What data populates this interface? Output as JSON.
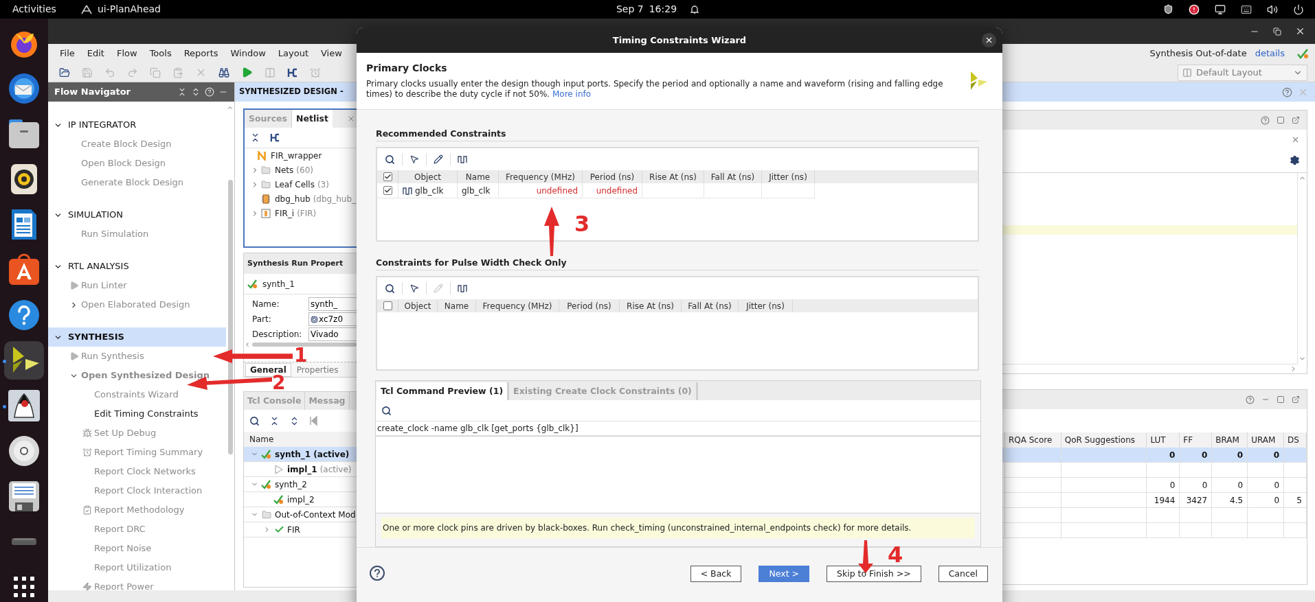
{
  "topbar": {
    "activities": "Activities",
    "app": "ui-PlanAhead",
    "date": "Sep 7",
    "time": "16:29"
  },
  "dock": [
    {
      "kind": "browser",
      "running": false,
      "selected": false
    },
    {
      "kind": "mail",
      "running": false,
      "selected": false
    },
    {
      "kind": "files",
      "running": false,
      "selected": false
    },
    {
      "kind": "music",
      "running": false,
      "selected": false
    },
    {
      "kind": "writer",
      "running": false,
      "selected": false
    },
    {
      "kind": "store",
      "running": false,
      "selected": false
    },
    {
      "kind": "help",
      "running": false,
      "selected": false
    },
    {
      "kind": "vivado",
      "running": true,
      "selected": true
    },
    {
      "kind": "mascot",
      "running": true,
      "selected": false
    },
    {
      "kind": "disc",
      "running": false,
      "selected": false
    },
    {
      "kind": "floppy",
      "running": false,
      "selected": false
    },
    {
      "kind": "drive",
      "running": false,
      "selected": false
    },
    {
      "kind": "apps",
      "running": false,
      "selected": false
    }
  ],
  "menu": [
    "File",
    "Edit",
    "Flow",
    "Tools",
    "Reports",
    "Window",
    "Layout",
    "View"
  ],
  "status": {
    "text": "Synthesis Out-of-date",
    "link": "details"
  },
  "layout_select": {
    "value": "Default Layout"
  },
  "flow_navigator": {
    "title": "Flow Navigator",
    "sections": [
      {
        "title": "IP INTEGRATOR",
        "expanded": true,
        "selected": false,
        "items": [
          {
            "label": "Create Block Design",
            "kind": "plain",
            "disabled": true
          },
          {
            "label": "Open Block Design",
            "kind": "plain",
            "disabled": true
          },
          {
            "label": "Generate Block Design",
            "kind": "plain",
            "disabled": true
          }
        ]
      },
      {
        "title": "SIMULATION",
        "expanded": true,
        "selected": false,
        "items": [
          {
            "label": "Run Simulation",
            "kind": "plain",
            "disabled": true
          }
        ]
      },
      {
        "title": "RTL ANALYSIS",
        "expanded": true,
        "selected": false,
        "items": [
          {
            "label": "Run Linter",
            "kind": "run",
            "disabled": true
          },
          {
            "label": "Open Elaborated Design",
            "kind": "group",
            "disabled": true,
            "expanded": false
          }
        ]
      },
      {
        "title": "SYNTHESIS",
        "expanded": true,
        "selected": true,
        "items": [
          {
            "label": "Run Synthesis",
            "kind": "run",
            "disabled": true
          },
          {
            "label": "Open Synthesized Design",
            "kind": "group",
            "disabled": true,
            "expanded": true,
            "children": [
              {
                "label": "Constraints Wizard",
                "kind": "plain",
                "disabled": true
              },
              {
                "label": "Edit Timing Constraints",
                "kind": "plain",
                "disabled": false
              },
              {
                "label": "Set Up Debug",
                "kind": "debug",
                "disabled": true
              },
              {
                "label": "Report Timing Summary",
                "kind": "timer",
                "disabled": true
              },
              {
                "label": "Report Clock Networks",
                "kind": "plain",
                "disabled": true
              },
              {
                "label": "Report Clock Interaction",
                "kind": "plain",
                "disabled": true
              },
              {
                "label": "Report Methodology",
                "kind": "checklist",
                "disabled": true
              },
              {
                "label": "Report DRC",
                "kind": "plain",
                "disabled": true
              },
              {
                "label": "Report Noise",
                "kind": "plain",
                "disabled": true
              },
              {
                "label": "Report Utilization",
                "kind": "plain",
                "disabled": true
              },
              {
                "label": "Report Power",
                "kind": "power",
                "disabled": true
              }
            ]
          }
        ]
      }
    ]
  },
  "design_header": "SYNTHESIZED DESIGN -",
  "netlist_panel": {
    "tabs": [
      {
        "label": "Sources",
        "selected": false
      },
      {
        "label": "Netlist",
        "selected": true
      }
    ],
    "tree": [
      {
        "label": "FIR_wrapper",
        "kind": "netlist",
        "children": [
          {
            "label": "Nets",
            "detail": "(60)",
            "kind": "folder",
            "expanded": false
          },
          {
            "label": "Leaf Cells",
            "detail": "(3)",
            "kind": "folder",
            "expanded": false
          },
          {
            "label": "dbg_hub",
            "detail": "(dbg_hub_",
            "kind": "core"
          },
          {
            "label": "FIR_i",
            "detail": "(FIR)",
            "kind": "block",
            "expanded": false
          }
        ]
      }
    ]
  },
  "properties_panel": {
    "title": "Synthesis Run Propert",
    "run": "synth_1",
    "fields": [
      {
        "label": "Name:",
        "value": "synth_",
        "kind": "text"
      },
      {
        "label": "Part:",
        "value": "xc7z0",
        "kind": "part"
      },
      {
        "label": "Description:",
        "value": "Vivado",
        "kind": "text"
      }
    ],
    "tabs": [
      {
        "label": "General",
        "selected": true
      },
      {
        "label": "Properties",
        "selected": false
      }
    ]
  },
  "console_panel": {
    "tabs": [
      {
        "label": "Tcl Console",
        "selected": false
      },
      {
        "label": "Messag",
        "selected": false
      }
    ]
  },
  "runs": {
    "name_column": "Name",
    "columns": [
      "RQA Score",
      "QoR Suggestions",
      "LUT",
      "FF",
      "BRAM",
      "URAM",
      "DS"
    ],
    "rows": [
      {
        "name": "synth_1 (active)",
        "active": true,
        "selected": true,
        "kind": "partial",
        "expanded": true,
        "cells": [
          null,
          null,
          "0",
          "0",
          "0",
          "0",
          null
        ],
        "children": [
          {
            "name": "impl_1",
            "detail": "(active)",
            "active": true,
            "selected": false,
            "kind": "pending",
            "cells": [
              null,
              null,
              null,
              null,
              null,
              null,
              null
            ]
          }
        ]
      },
      {
        "name": "synth_2",
        "active": false,
        "selected": false,
        "kind": "partial",
        "expanded": true,
        "cells": [
          null,
          null,
          "0",
          "0",
          "0",
          "0",
          null
        ],
        "children": [
          {
            "name": "impl_2",
            "active": false,
            "selected": false,
            "kind": "partial",
            "cells": [
              null,
              null,
              "1944",
              "3427",
              "4.5",
              "0",
              "5"
            ]
          }
        ]
      },
      {
        "name": "Out-of-Context Mod",
        "active": false,
        "selected": false,
        "kind": "folder",
        "expanded": true,
        "cells": [
          null,
          null,
          null,
          null,
          null,
          null,
          null
        ],
        "children": [
          {
            "name": "FIR",
            "active": false,
            "selected": false,
            "kind": "complete",
            "expanded": false,
            "cells": [
              null,
              null,
              null,
              null,
              null,
              null,
              null
            ]
          }
        ]
      }
    ]
  },
  "dialog": {
    "title": "Timing Constraints Wizard",
    "heading": "Primary Clocks",
    "description": "Primary clocks usually enter the design though input ports. Specify the period and optionally a name and waveform (rising and falling edge times) to describe the duty cycle if not 50%.",
    "more_info": "More info",
    "recommended": {
      "title": "Recommended Constraints",
      "all_checked": true,
      "edit_enabled": true,
      "columns": [
        "Object",
        "Name",
        "Frequency (MHz)",
        "Period (ns)",
        "Rise At (ns)",
        "Fall At (ns)",
        "Jitter (ns)"
      ],
      "rows": [
        {
          "checked": true,
          "cells": [
            {
              "text": "glb_clk",
              "invalid": false
            },
            {
              "text": "glb_clk",
              "invalid": false
            },
            {
              "text": "undefined",
              "invalid": true
            },
            {
              "text": "undefined",
              "invalid": true
            },
            null,
            null,
            null
          ]
        }
      ]
    },
    "pulse": {
      "title": "Constraints for Pulse Width Check Only",
      "all_checked": false,
      "edit_enabled": false,
      "columns": [
        "Object",
        "Name",
        "Frequency (MHz)",
        "Period (ns)",
        "Rise At (ns)",
        "Fall At (ns)",
        "Jitter (ns)"
      ]
    },
    "tabs": [
      {
        "label": "Tcl Command Preview (1)",
        "selected": true
      },
      {
        "label": "Existing Create Clock Constraints (0)",
        "selected": false
      }
    ],
    "commands": [
      "create_clock -name glb_clk [get_ports {glb_clk}]"
    ],
    "warning": "One or more clock pins are driven by black-boxes. Run check_timing (unconstrained_internal_endpoints check) for more details.",
    "buttons": [
      {
        "label": "< Back",
        "primary": false
      },
      {
        "label": "Next >",
        "primary": true
      },
      {
        "label": "Skip to Finish >>",
        "primary": false
      },
      {
        "label": "Cancel",
        "primary": false
      }
    ]
  },
  "annotations": [
    {
      "label": "1"
    },
    {
      "label": "2"
    },
    {
      "label": "3"
    },
    {
      "label": "4"
    }
  ]
}
